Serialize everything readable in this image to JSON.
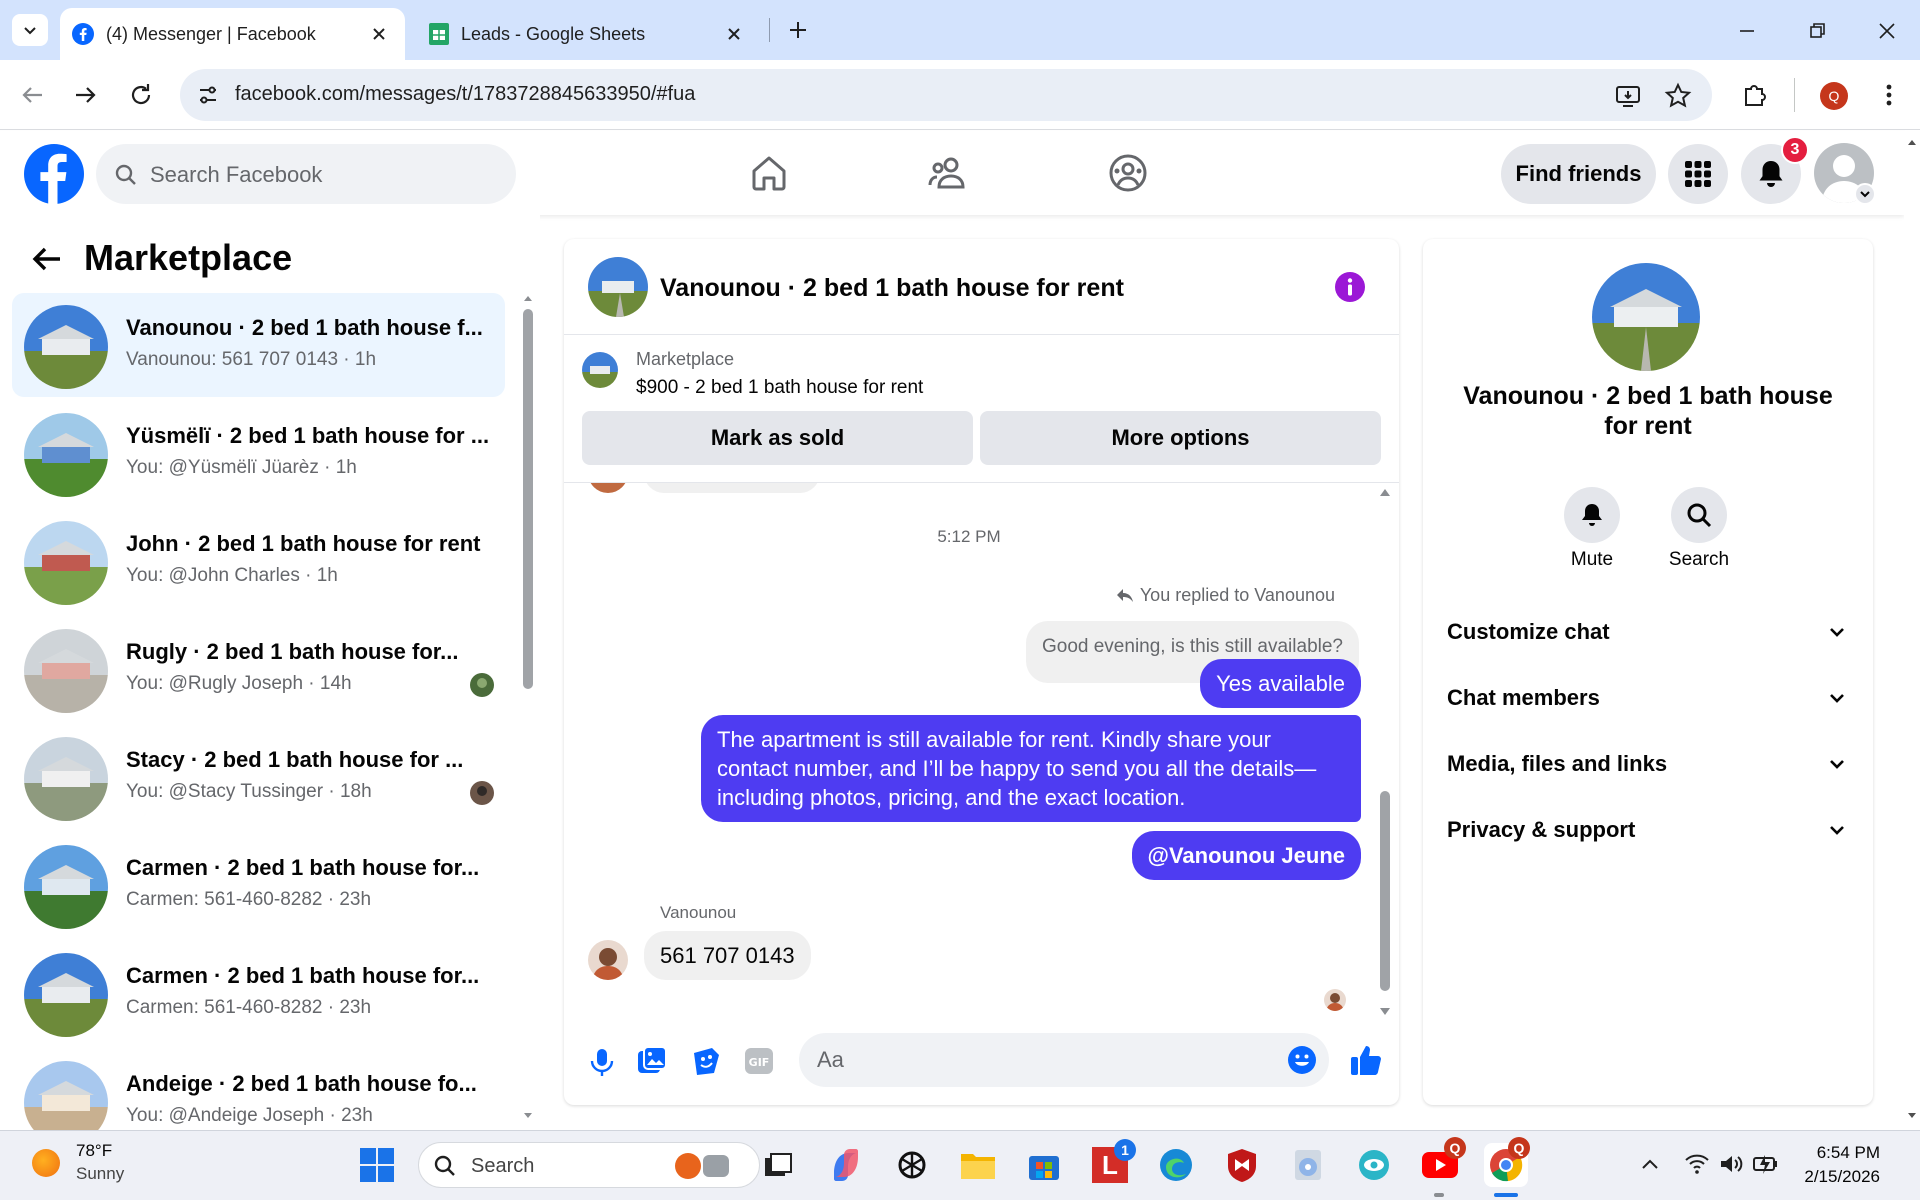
{
  "browser": {
    "tabs": [
      {
        "title": "(4) Messenger | Facebook",
        "active": true
      },
      {
        "title": "Leads - Google Sheets",
        "active": false
      }
    ],
    "url": "facebook.com/messages/t/1783728845633950/#fua"
  },
  "fb_header": {
    "search_placeholder": "Search Facebook",
    "find_friends": "Find friends",
    "notification_count": "3"
  },
  "sidebar": {
    "title": "Marketplace",
    "conversations": [
      {
        "name": "Vanounou · 2 bed 1 bath house f...",
        "sub": "Vanounou: 561 707 0143 · 1h",
        "selected": true
      },
      {
        "name": "Yüsmëlï · 2 bed 1 bath house for ...",
        "sub": "You: @Yüsmëlï Jüarèz · 1h"
      },
      {
        "name": "John · 2 bed 1 bath house for rent",
        "sub": "You: @John Charles · 1h"
      },
      {
        "name": "Rugly · 2 bed 1 bath house for...",
        "sub": "You: @Rugly Joseph · 14h"
      },
      {
        "name": "Stacy · 2 bed 1 bath house for ...",
        "sub": "You: @Stacy Tussinger · 18h"
      },
      {
        "name": "Carmen · 2 bed 1 bath house for...",
        "sub": "Carmen: 561-460-8282 · 23h"
      },
      {
        "name": "Carmen · 2 bed 1 bath house for...",
        "sub": "Carmen: 561-460-8282 · 23h"
      },
      {
        "name": "Andeige · 2 bed 1 bath house fo...",
        "sub": "You: @Andeige Joseph · 23h"
      }
    ]
  },
  "chat": {
    "title": "Vanounou · 2 bed 1 bath house for rent",
    "listing_label": "Marketplace",
    "listing_title": "$900 - 2 bed 1 bath house for rent",
    "mark_sold": "Mark as sold",
    "more_options": "More options",
    "timestamp": "5:12 PM",
    "reply_note": "You replied to Vanounou",
    "quoted": "Good evening, is this still available?",
    "out_1": "Yes available",
    "out_2": "The apartment is still available for rent. Kindly share your contact number, and I’ll be happy to send you all the details—including photos, pricing, and the exact location.",
    "out_3": "@Vanounou Jeune",
    "sender": "Vanounou",
    "in_1": "561 707 0143",
    "input_placeholder": "Aa"
  },
  "info_panel": {
    "title": "Vanounou · 2 bed 1 bath house for rent",
    "mute": "Mute",
    "search": "Search",
    "sections": [
      "Customize chat",
      "Chat members",
      "Media, files and links",
      "Privacy & support"
    ]
  },
  "taskbar": {
    "weather_temp": "78°F",
    "weather_desc": "Sunny",
    "search_placeholder": "Search",
    "time": "6:54 PM",
    "date": "2/15/2026",
    "lastpass_badge": "1",
    "youtube_badge": "Q",
    "chrome_badge": "Q"
  },
  "colors": {
    "fb_blue": "#0866ff",
    "bubble_purple": "#4e3cf2",
    "selected_row": "#ebf5ff",
    "badge_red": "#e41e3f"
  }
}
